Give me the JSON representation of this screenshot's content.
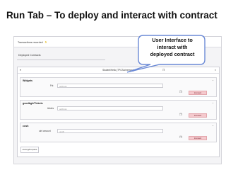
{
  "slide": {
    "title": "Run Tab – To deploy and interact with contract"
  },
  "callout": {
    "lines": [
      "User Interface to",
      "interact with",
      "deployed contract"
    ]
  },
  "panel": {
    "transactions_label": "Transactions recorded",
    "transactions_badge": "5",
    "deployed_contracts_label": "Deployed Contracts"
  },
  "contract": {
    "title": "Student/Hello (TPCSo/memory)",
    "caret": "▾",
    "copy_icon": "copy-icon",
    "close_icon": "×"
  },
  "functions": [
    {
      "name": "Widgets",
      "param_label": "Fst",
      "placeholder": "address",
      "button": "transact"
    },
    {
      "name": "goodbgh/Tickets",
      "param_label": "tickets",
      "placeholder": "address",
      "button": "transact"
    },
    {
      "name": "cosh",
      "param_label": "uint amount",
      "placeholder": "uint8",
      "button": "transact"
    }
  ],
  "bottom_button": "storing/Forpass",
  "colors": {
    "callout_border": "#6b8ad6",
    "button_bg": "#f4c9cd",
    "panel_bg": "#f4f4f6"
  }
}
